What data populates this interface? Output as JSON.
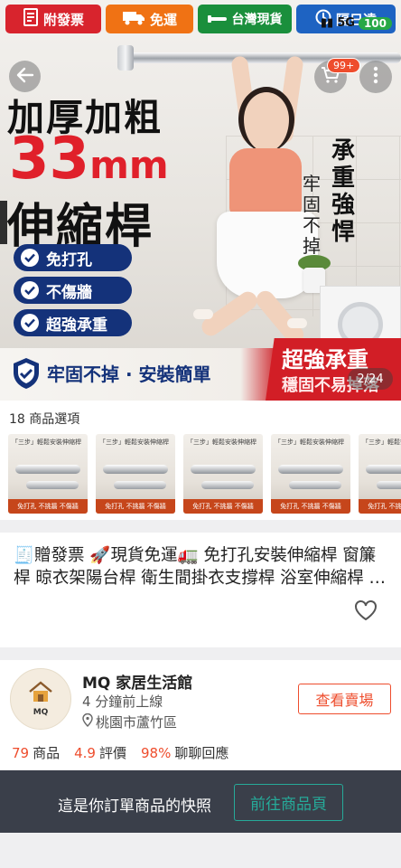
{
  "badges": {
    "invoice": "附發票",
    "free_shipping": "免運",
    "taiwan_stock": "台灣現貨",
    "express": "隔日達"
  },
  "status": {
    "signal": "5G",
    "battery": "100"
  },
  "hero": {
    "cart_count": "99+",
    "headline1": "加厚加粗",
    "headline2_num": "33",
    "headline2_unit": "mm",
    "headline3": "伸縮桿",
    "features": [
      "免打孔",
      "不傷牆",
      "超強承重"
    ],
    "vertical_bold": "承重強悍",
    "vertical_light": "牢固不掉",
    "banner_left": "牢固不掉 · 安裝簡單",
    "banner_right_1": "超強承重",
    "banner_right_2": "穩固不易掉落",
    "image_counter": "2/24"
  },
  "options": {
    "label": "18 商品選項",
    "thumb_top": "「三步」輕鬆安裝伸縮桿",
    "thumb_foot": "免打孔 不挑牆 不傷牆",
    "thumb_count": 5
  },
  "product": {
    "title": "🧾贈發票 🚀現貨免運🚛 免打孔安裝伸縮桿 窗簾桿 晾衣架陽台桿 衛生間掛衣支撐桿 浴室伸縮桿 加厚加粗"
  },
  "shop": {
    "name": "MQ 家居生活館",
    "online": "4 分鐘前上線",
    "location": "桃園市蘆竹區",
    "view_button": "查看賣場",
    "avatar_text": "MQ",
    "stats": [
      {
        "num": "79",
        "label": "商品"
      },
      {
        "num": "4.9",
        "label": "評價"
      },
      {
        "num": "98%",
        "label": "聊聊回應"
      }
    ]
  },
  "snapshot": {
    "text": "這是你訂單商品的快照",
    "button": "前往商品頁"
  },
  "colors": {
    "accent": "#ee4d2d",
    "teal": "#26aa99",
    "navy": "#14327a",
    "red": "#d8242d"
  }
}
